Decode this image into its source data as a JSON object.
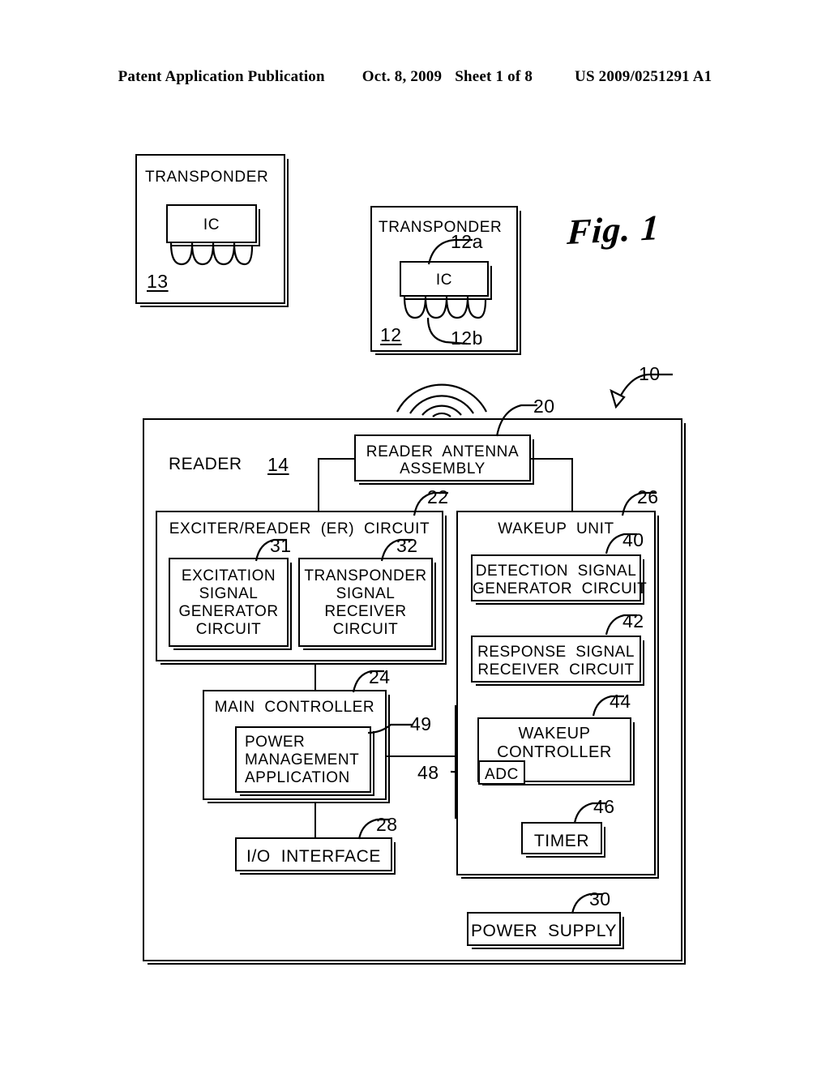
{
  "header": {
    "title": "Patent Application Publication",
    "date": "Oct. 8, 2009",
    "sheet": "Sheet 1 of 8",
    "number": "US 2009/0251291 A1"
  },
  "figure": {
    "caption": "Fig. 1"
  },
  "transponder_13": {
    "title": "TRANSPONDER",
    "ic_label": "IC",
    "ref": "13"
  },
  "transponder_12": {
    "title": "TRANSPONDER",
    "ic_label": "IC",
    "ref": "12",
    "ref_ic": "12a",
    "ref_coil": "12b"
  },
  "system": {
    "ref": "10"
  },
  "reader": {
    "title": "READER",
    "ref": "14",
    "antenna": {
      "label": "READER  ANTENNA\nASSEMBLY",
      "ref": "20"
    },
    "er_circuit": {
      "title": "EXCITER/READER  (ER)  CIRCUIT",
      "ref": "22",
      "blocks": [
        {
          "label": "EXCITATION\nSIGNAL\nGENERATOR\nCIRCUIT",
          "ref": "31"
        },
        {
          "label": "TRANSPONDER\nSIGNAL\nRECEIVER\nCIRCUIT",
          "ref": "32"
        }
      ]
    },
    "main_controller": {
      "title": "MAIN  CONTROLLER",
      "ref": "24",
      "application": {
        "label": "POWER\nMANAGEMENT\nAPPLICATION",
        "ref": "49"
      }
    },
    "io_interface": {
      "label": "I/O  INTERFACE",
      "ref": "28"
    },
    "power_supply": {
      "label": "POWER  SUPPLY",
      "ref": "30"
    },
    "adc_link_ref": "48",
    "wakeup_unit": {
      "title": "WAKEUP  UNIT",
      "ref": "26",
      "blocks": [
        {
          "label": "DETECTION  SIGNAL\nGENERATOR  CIRCUIT",
          "ref": "40"
        },
        {
          "label": "RESPONSE  SIGNAL\nRECEIVER  CIRCUIT",
          "ref": "42"
        },
        {
          "label": "WAKEUP\nCONTROLLER",
          "ref": "44",
          "adc_label": "ADC"
        },
        {
          "label": "TIMER",
          "ref": "46"
        }
      ]
    }
  }
}
